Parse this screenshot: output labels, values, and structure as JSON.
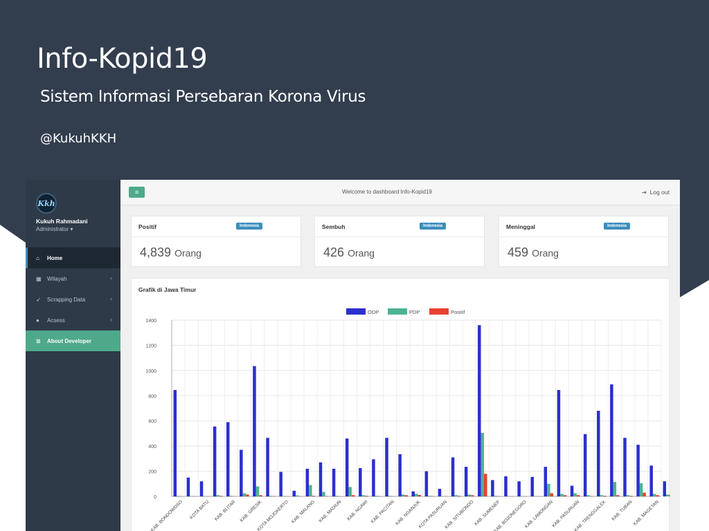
{
  "hero": {
    "title": "Info-Kopid19",
    "subtitle": "Sistem Informasi Persebaran Korona Virus",
    "handle": "@KukuhKKH"
  },
  "sidebar": {
    "avatar_text": "Kkh",
    "user_name": "Kukuh Rahmadani",
    "user_role": "Administrator",
    "items": [
      {
        "label": "Home",
        "icon": "home-icon",
        "glyph": "⌂",
        "active": true
      },
      {
        "label": "Wilayah",
        "icon": "grid-icon",
        "glyph": "▦",
        "chevron": "‹"
      },
      {
        "label": "Scrapping Data",
        "icon": "rocket-icon",
        "glyph": "➶",
        "chevron": "‹"
      },
      {
        "label": "Acsess",
        "icon": "user-icon",
        "glyph": "●",
        "chevron": "‹"
      },
      {
        "label": "About Developer",
        "icon": "database-icon",
        "glyph": "≣",
        "highlight": true
      }
    ]
  },
  "topbar": {
    "toggle_glyph": "≡",
    "welcome": "Welcome to dashboard Info-Kopid19",
    "logout_icon": "⇥",
    "logout": "Log out"
  },
  "cards": [
    {
      "title": "Positif",
      "badge": "Indonesia",
      "value": "4,839",
      "unit": "Orang"
    },
    {
      "title": "Sembuh",
      "badge": "Indonesia",
      "value": "426",
      "unit": "Orang"
    },
    {
      "title": "Meninggal",
      "badge": "Indonesia",
      "value": "459",
      "unit": "Orang"
    }
  ],
  "colors": {
    "odp": "#2b2fce",
    "pdp": "#4db394",
    "positif": "#e8412f",
    "accent": "#4ea98a",
    "sidebar": "#2e3a48",
    "hero": "#323e4e"
  },
  "chart_data": {
    "type": "bar",
    "title": "Grafik di Jawa Timur",
    "ylim": [
      0,
      1400
    ],
    "yticks": [
      0,
      200,
      400,
      600,
      800,
      1000,
      1200,
      1400
    ],
    "grid": true,
    "legend_position": "top",
    "categories": [
      "KAB. BONDOWOSO",
      "",
      "KOTA BATU",
      "",
      "KAB. BLITAR",
      "",
      "KAB. GRESIK",
      "",
      "KOTA MOJOKERTO",
      "",
      "KAB. MALANG",
      "",
      "KAB. MADIUN",
      "",
      "KAB. NGAWI",
      "",
      "KAB. PACITAN",
      "",
      "KAB. NGANJUK",
      "",
      "KOTA PASURUAN",
      "",
      "KAB. SITUBONDO",
      "",
      "KAB. SUMENEP",
      "",
      "KAB. BOJONEGORO",
      "",
      "KAB. LAMONGAN",
      "",
      "KAB. PASURUAN",
      "",
      "KAB. TRENGGALEK",
      "",
      "KAB. TUBAN",
      "",
      "KAB. MAGETAN"
    ],
    "series": [
      {
        "name": "ODP",
        "values": [
          845,
          150,
          120,
          555,
          590,
          370,
          1035,
          465,
          195,
          45,
          220,
          270,
          220,
          460,
          225,
          295,
          465,
          335,
          40,
          200,
          60,
          310,
          235,
          1360,
          130,
          160,
          120,
          155,
          235,
          845,
          85,
          495,
          680,
          890,
          465,
          410,
          245,
          120
        ]
      },
      {
        "name": "PDP",
        "values": [
          5,
          3,
          3,
          10,
          5,
          25,
          80,
          5,
          3,
          8,
          90,
          35,
          5,
          75,
          10,
          5,
          5,
          15,
          20,
          5,
          3,
          10,
          15,
          505,
          5,
          3,
          3,
          3,
          100,
          20,
          25,
          10,
          10,
          115,
          10,
          105,
          20,
          15
        ]
      },
      {
        "name": "Positif",
        "values": [
          2,
          2,
          2,
          5,
          2,
          15,
          10,
          3,
          2,
          2,
          5,
          3,
          2,
          10,
          5,
          3,
          2,
          10,
          12,
          3,
          2,
          5,
          10,
          180,
          3,
          2,
          2,
          2,
          25,
          10,
          10,
          3,
          5,
          10,
          5,
          30,
          10,
          10
        ]
      }
    ]
  }
}
